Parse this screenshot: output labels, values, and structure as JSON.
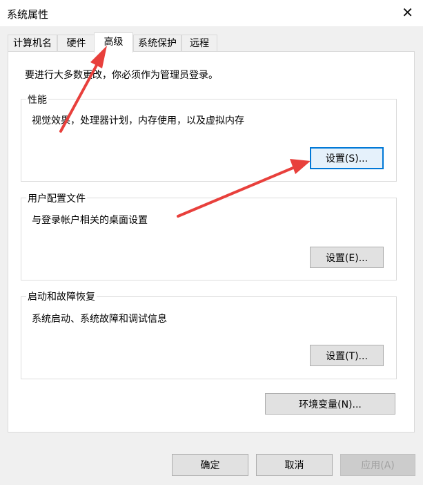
{
  "window": {
    "title": "系统属性",
    "close_glyph": "✕"
  },
  "tabs": [
    {
      "label": "计算机名",
      "active": false
    },
    {
      "label": "硬件",
      "active": false
    },
    {
      "label": "高级",
      "active": true
    },
    {
      "label": "系统保护",
      "active": false
    },
    {
      "label": "远程",
      "active": false
    }
  ],
  "notice": "要进行大多数更改，你必须作为管理员登录。",
  "performance": {
    "title": "性能",
    "description": "视觉效果，处理器计划，内存使用，以及虚拟内存",
    "button": "设置(S)..."
  },
  "user_profiles": {
    "title": "用户配置文件",
    "description": "与登录帐户相关的桌面设置",
    "button": "设置(E)..."
  },
  "startup_recovery": {
    "title": "启动和故障恢复",
    "description": "系统启动、系统故障和调试信息",
    "button": "设置(T)..."
  },
  "env_button": "环境变量(N)...",
  "footer": {
    "ok": "确定",
    "cancel": "取消",
    "apply": "应用(A)"
  },
  "colors": {
    "annotation_arrow": "#e8403c",
    "focus_border": "#0078d7"
  }
}
